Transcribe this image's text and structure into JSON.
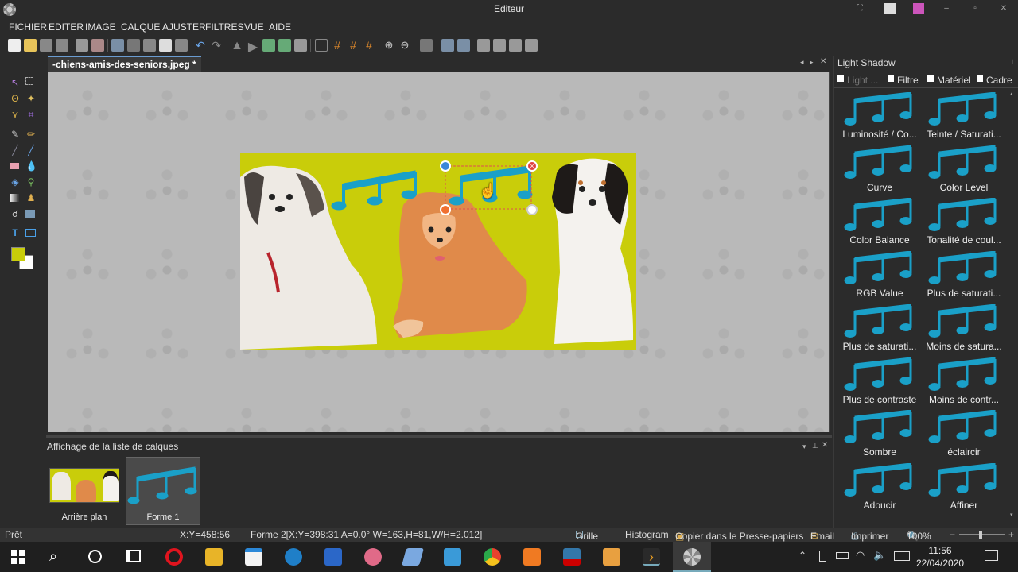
{
  "window": {
    "title": "Editeur"
  },
  "menu": [
    "FICHIER",
    "EDITER",
    "IMAGE",
    "CALQUE",
    "AJUSTER",
    "FILTRES",
    "VUE",
    "AIDE"
  ],
  "document_tab": "-chiens-amis-des-seniors.jpeg *",
  "colors": {
    "foreground": "#c9cd0a",
    "background": "#ffffff",
    "accent": "#1aa0c8"
  },
  "layers_panel": {
    "title": "Affichage de la liste de calques",
    "layers": [
      {
        "label": "Arrière plan"
      },
      {
        "label": "Forme 1"
      }
    ]
  },
  "right_panel": {
    "title": "Light Shadow",
    "tabs": [
      "Light ...",
      "Filtre",
      "Matériel",
      "Cadre"
    ],
    "effects": [
      "Luminosité / Co...",
      "Teinte / Saturati...",
      "Curve",
      "Color Level",
      "Color Balance",
      "Tonalité de coul...",
      "RGB Value",
      "Plus de saturati...",
      "Plus de saturati...",
      "Moins de satura...",
      "Plus de contraste",
      "Moins de contr...",
      "Sombre",
      "éclaircir",
      "Adoucir",
      "Affiner"
    ]
  },
  "status": {
    "ready": "Prêt",
    "xy": "X:Y=458:56",
    "shape_info": "Forme 2[X:Y=398:31 A=0.0° W=163,H=81,W/H=2.012]",
    "grid": "Grille",
    "histogram": "Histogram",
    "copy": "Copier dans le Presse-papiers",
    "email": "Email",
    "print": "Imprimer",
    "zoom": "100%"
  },
  "taskbar": {
    "time": "11:56",
    "date": "22/04/2020"
  }
}
